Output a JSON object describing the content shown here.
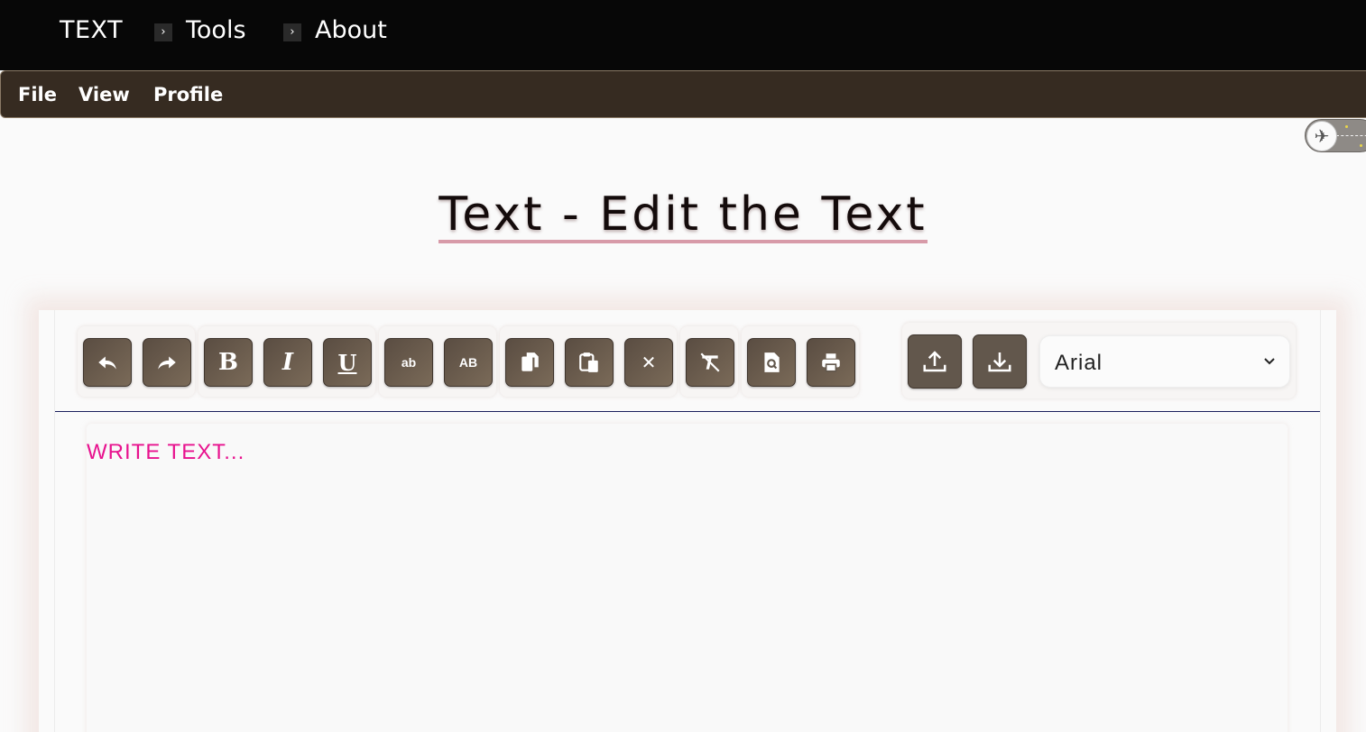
{
  "nav": {
    "brand": "TEXT",
    "crumbs": [
      {
        "label": "Tools"
      },
      {
        "label": "About"
      }
    ],
    "crumb_separator": "›"
  },
  "menu": {
    "items": [
      "File",
      "View",
      "Profile"
    ]
  },
  "theme_toggle": {
    "icon": "airplane-icon",
    "state": "off"
  },
  "page": {
    "title": "Text - Edit the Text"
  },
  "toolbar": {
    "buttons": [
      {
        "name": "undo",
        "icon": "undo-icon"
      },
      {
        "name": "redo",
        "icon": "redo-icon"
      },
      {
        "name": "bold",
        "icon": "bold-icon",
        "glyph": "B"
      },
      {
        "name": "italic",
        "icon": "italic-icon",
        "glyph": "I"
      },
      {
        "name": "underline",
        "icon": "underline-icon",
        "glyph": "U"
      },
      {
        "name": "lowercase",
        "icon": "lowercase-icon",
        "glyph": "ab"
      },
      {
        "name": "uppercase",
        "icon": "uppercase-icon",
        "glyph": "AB"
      },
      {
        "name": "copy",
        "icon": "copy-icon"
      },
      {
        "name": "paste",
        "icon": "paste-icon"
      },
      {
        "name": "clear",
        "icon": "close-icon",
        "glyph": "✕"
      },
      {
        "name": "clear-format",
        "icon": "clear-format-icon"
      },
      {
        "name": "find",
        "icon": "find-icon"
      },
      {
        "name": "print",
        "icon": "print-icon"
      },
      {
        "name": "upload",
        "icon": "upload-icon"
      },
      {
        "name": "download",
        "icon": "download-icon"
      }
    ],
    "font": {
      "selected": "Arial"
    }
  },
  "editor": {
    "placeholder": "WRITE TEXT..."
  },
  "colors": {
    "topbar": "#070707",
    "menubar": "#362b21",
    "button": "#62574c",
    "placeholder": "#e8128e",
    "title_underline": "#d79aa8",
    "divider": "#1b1f5c"
  }
}
